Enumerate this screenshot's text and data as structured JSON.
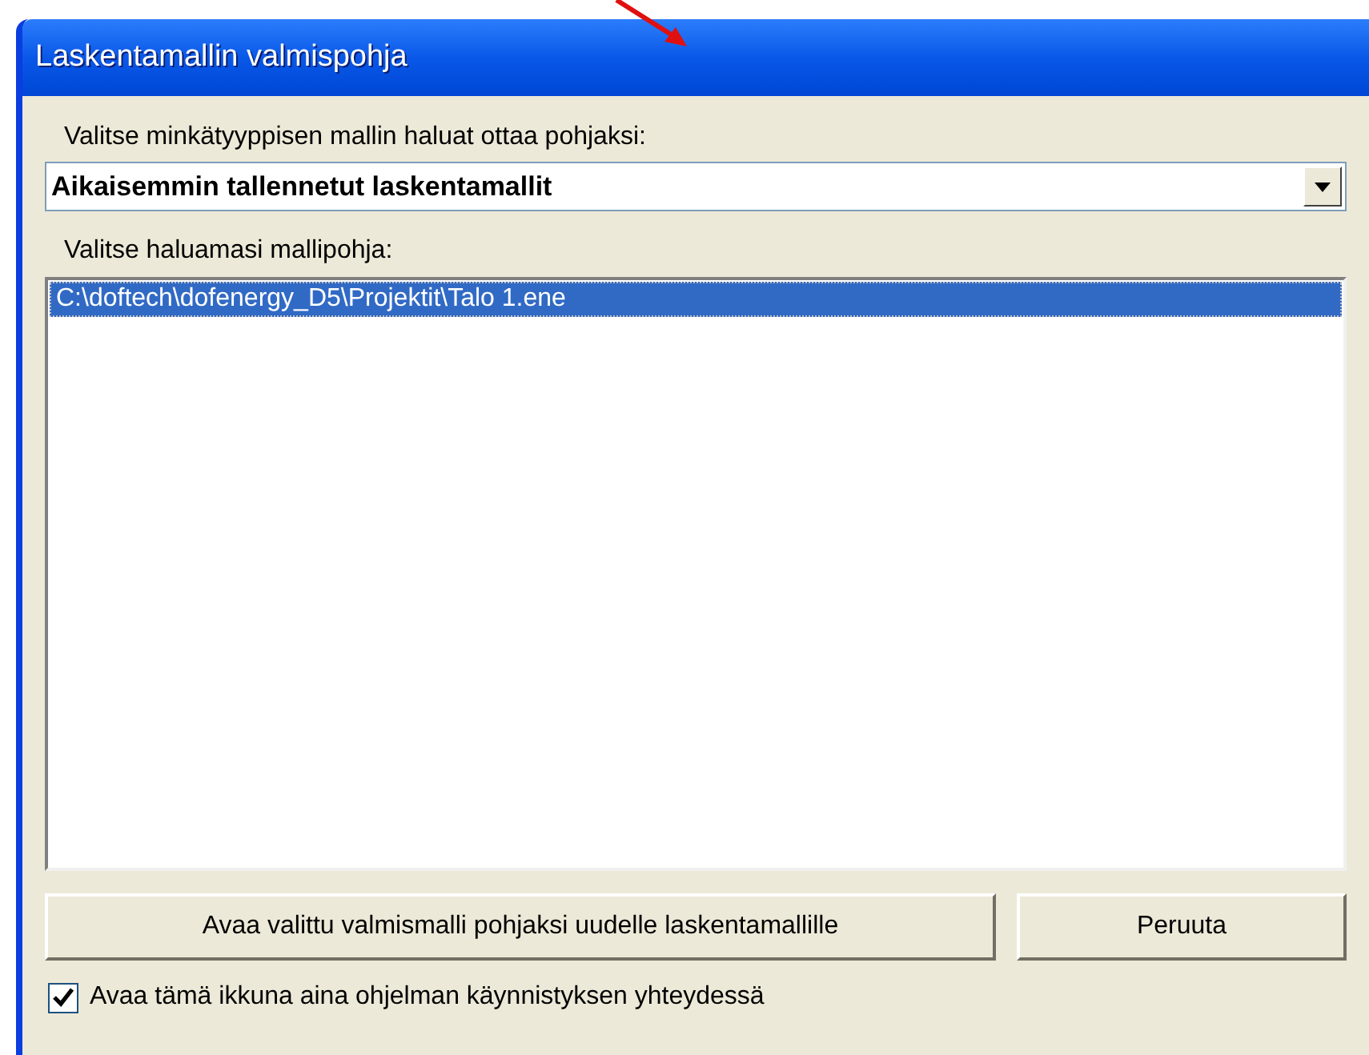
{
  "window": {
    "title": "Laskentamallin valmispohja"
  },
  "type_label": "Valitse minkätyyppisen mallin haluat ottaa pohjaksi:",
  "type_select": {
    "value": "Aikaisemmin tallennetut laskentamallit"
  },
  "template_label": "Valitse haluamasi mallipohja:",
  "templates": [
    {
      "label": "C:\\doftech\\dofenergy_D5\\Projektit\\Talo 1.ene",
      "selected": true
    }
  ],
  "buttons": [
    {
      "label": "Avaa valittu valmismalli pohjaksi uudelle laskentamallille"
    },
    {
      "label": "Peruuta"
    }
  ],
  "startup_checkbox": {
    "label": "Avaa tämä ikkuna aina ohjelman käynnistyksen yhteydessä",
    "checked": true
  }
}
